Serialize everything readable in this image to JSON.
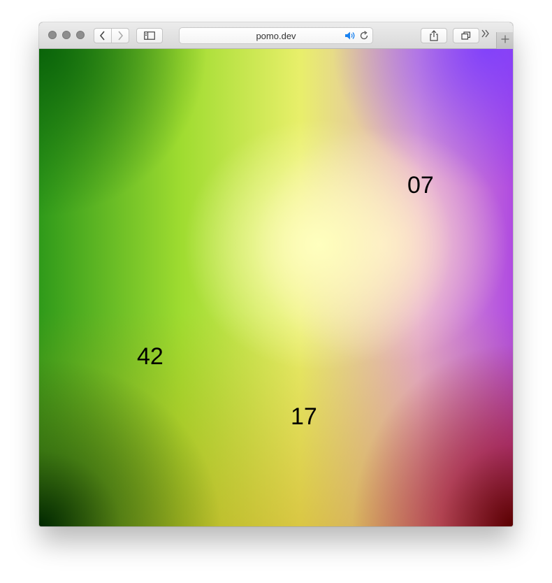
{
  "browser": {
    "url": "pomo.dev",
    "icons": {
      "back": "chevron-left-icon",
      "forward": "chevron-right-icon",
      "sidebar": "sidebar-icon",
      "audio": "speaker-icon",
      "reload": "reload-icon",
      "share": "share-icon",
      "tabs": "tabs-icon",
      "more": "double-chevron-icon",
      "new_tab": "plus-icon"
    }
  },
  "canvas": {
    "numbers": [
      {
        "label": "07"
      },
      {
        "label": "42"
      },
      {
        "label": "17"
      }
    ]
  }
}
